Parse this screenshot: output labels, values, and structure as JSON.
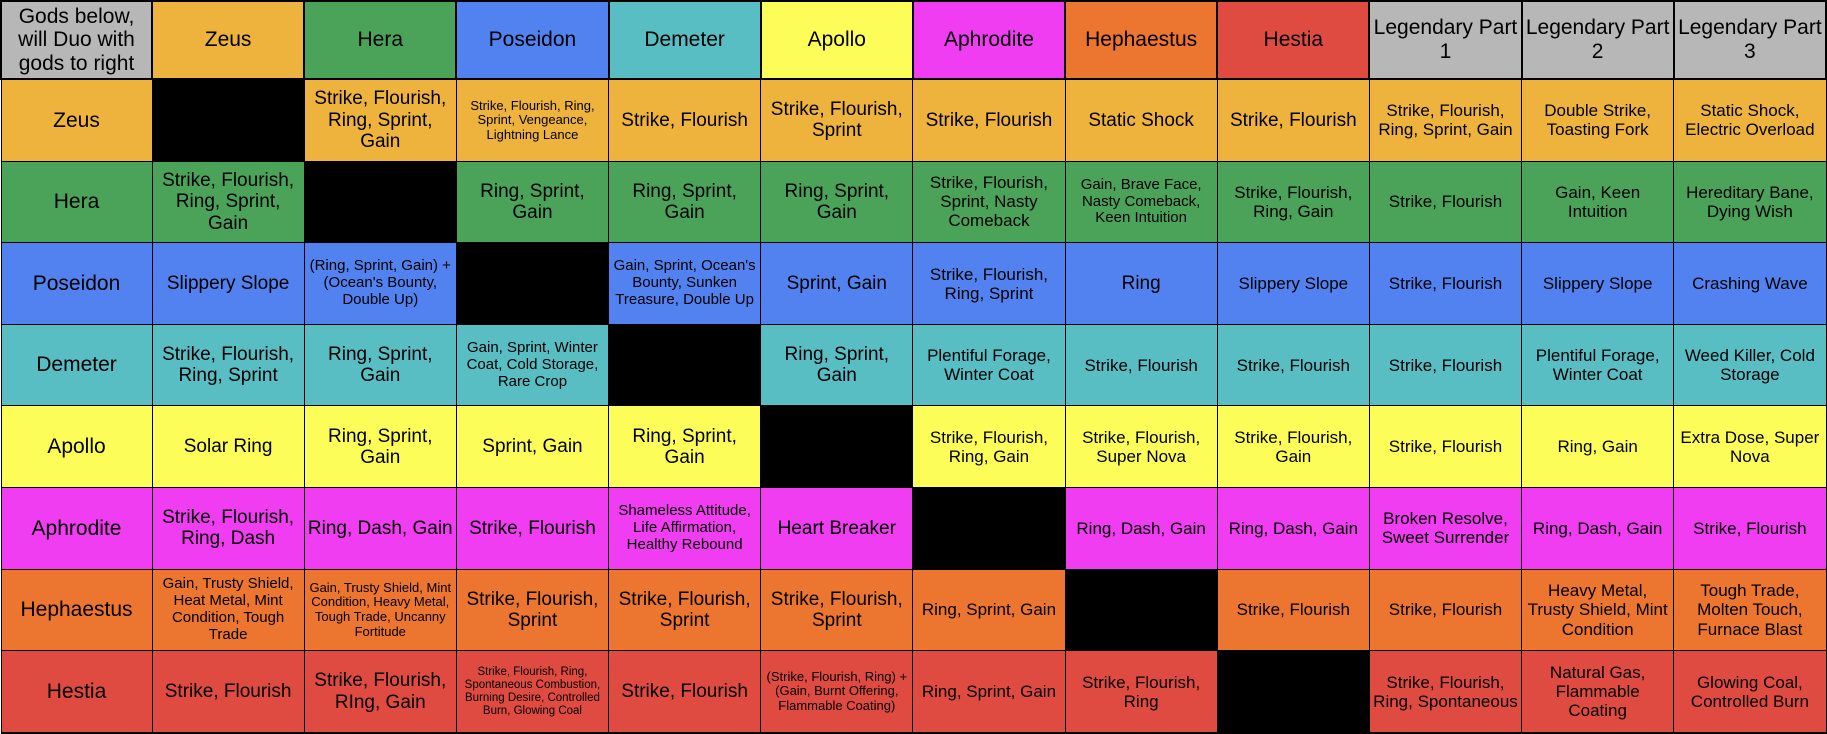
{
  "table": {
    "corner_label": "Gods below, will Duo with gods to right",
    "columns": [
      {
        "name": "Zeus",
        "color": "#eeb33c"
      },
      {
        "name": "Hera",
        "color": "#4ba35a"
      },
      {
        "name": "Poseidon",
        "color": "#5282ef"
      },
      {
        "name": "Demeter",
        "color": "#59bec4"
      },
      {
        "name": "Apollo",
        "color": "#fdfd59"
      },
      {
        "name": "Aphrodite",
        "color": "#f13df1"
      },
      {
        "name": "Hephaestus",
        "color": "#ec7530"
      },
      {
        "name": "Hestia",
        "color": "#df4b41"
      },
      {
        "name": "Legendary Part 1",
        "color": "#b7b7b7"
      },
      {
        "name": "Legendary Part 2",
        "color": "#b7b7b7"
      },
      {
        "name": "Legendary Part 3",
        "color": "#b7b7b7"
      }
    ],
    "rows": [
      {
        "label": "Zeus",
        "color": "#eeb33c",
        "cells": [
          {
            "text": "",
            "blank": true
          },
          {
            "text": "Strike, Flourish, Ring, Sprint, Gain",
            "size": "fs-lg"
          },
          {
            "text": "Strike, Flourish, Ring, Sprint, Vengeance, Lightning Lance",
            "size": "fs-xs"
          },
          {
            "text": "Strike, Flourish",
            "size": "fs-lg"
          },
          {
            "text": "Strike, Flourish, Sprint",
            "size": "fs-lg"
          },
          {
            "text": "Strike, Flourish",
            "size": "fs-lg"
          },
          {
            "text": "Static Shock",
            "size": "fs-lg"
          },
          {
            "text": "Strike, Flourish",
            "size": "fs-lg"
          },
          {
            "text": "Strike, Flourish, Ring, Sprint, Gain",
            "size": "fs-md"
          },
          {
            "text": "Double Strike, Toasting Fork",
            "size": "fs-md"
          },
          {
            "text": "Static Shock, Electric Overload",
            "size": "fs-md"
          }
        ]
      },
      {
        "label": "Hera",
        "color": "#4ba35a",
        "cells": [
          {
            "text": "Strike, Flourish, Ring, Sprint, Gain",
            "size": "fs-lg"
          },
          {
            "text": "",
            "blank": true
          },
          {
            "text": "Ring, Sprint, Gain",
            "size": "fs-lg"
          },
          {
            "text": "Ring, Sprint, Gain",
            "size": "fs-lg"
          },
          {
            "text": "Ring, Sprint, Gain",
            "size": "fs-lg"
          },
          {
            "text": "Strike, Flourish, Sprint, Nasty Comeback",
            "size": "fs-md"
          },
          {
            "text": "Gain, Brave Face, Nasty Comeback, Keen Intuition",
            "size": "fs-sm"
          },
          {
            "text": "Strike, Flourish, Ring, Gain",
            "size": "fs-md"
          },
          {
            "text": "Strike, Flourish",
            "size": "fs-md"
          },
          {
            "text": "Gain, Keen Intuition",
            "size": "fs-md"
          },
          {
            "text": "Hereditary Bane, Dying Wish",
            "size": "fs-md"
          }
        ]
      },
      {
        "label": "Poseidon",
        "color": "#5282ef",
        "cells": [
          {
            "text": "Slippery Slope",
            "size": "fs-lg"
          },
          {
            "text": "(Ring, Sprint, Gain) + (Ocean's Bounty, Double Up)",
            "size": "fs-sm"
          },
          {
            "text": "",
            "blank": true
          },
          {
            "text": "Gain, Sprint, Ocean's Bounty, Sunken Treasure, Double Up",
            "size": "fs-sm"
          },
          {
            "text": "Sprint, Gain",
            "size": "fs-lg"
          },
          {
            "text": "Strike, Flourish, Ring, Sprint",
            "size": "fs-md"
          },
          {
            "text": "Ring",
            "size": "fs-lg"
          },
          {
            "text": "Slippery Slope",
            "size": "fs-md"
          },
          {
            "text": "Strike, Flourish",
            "size": "fs-md"
          },
          {
            "text": "Slippery Slope",
            "size": "fs-md"
          },
          {
            "text": "Crashing Wave",
            "size": "fs-md"
          }
        ]
      },
      {
        "label": "Demeter",
        "color": "#59bec4",
        "cells": [
          {
            "text": "Strike, Flourish, Ring, Sprint",
            "size": "fs-lg"
          },
          {
            "text": "Ring, Sprint, Gain",
            "size": "fs-lg"
          },
          {
            "text": "Gain, Sprint, Winter Coat, Cold Storage, Rare Crop",
            "size": "fs-sm"
          },
          {
            "text": "",
            "blank": true
          },
          {
            "text": "Ring, Sprint, Gain",
            "size": "fs-lg"
          },
          {
            "text": "Plentiful Forage, Winter Coat",
            "size": "fs-md"
          },
          {
            "text": "Strike, Flourish",
            "size": "fs-md"
          },
          {
            "text": "Strike, Flourish",
            "size": "fs-md"
          },
          {
            "text": "Strike, Flourish",
            "size": "fs-md"
          },
          {
            "text": "Plentiful Forage, Winter Coat",
            "size": "fs-md"
          },
          {
            "text": "Weed Killer, Cold Storage",
            "size": "fs-md"
          }
        ]
      },
      {
        "label": "Apollo",
        "color": "#fdfd59",
        "cells": [
          {
            "text": "Solar Ring",
            "size": "fs-lg"
          },
          {
            "text": "Ring, Sprint, Gain",
            "size": "fs-lg"
          },
          {
            "text": "Sprint, Gain",
            "size": "fs-lg"
          },
          {
            "text": "Ring, Sprint, Gain",
            "size": "fs-lg"
          },
          {
            "text": "",
            "blank": true
          },
          {
            "text": "Strike, Flourish, Ring, Gain",
            "size": "fs-md"
          },
          {
            "text": "Strike, Flourish, Super Nova",
            "size": "fs-md"
          },
          {
            "text": "Strike, Flourish, Gain",
            "size": "fs-md"
          },
          {
            "text": "Strike, Flourish",
            "size": "fs-md"
          },
          {
            "text": "Ring, Gain",
            "size": "fs-md"
          },
          {
            "text": "Extra Dose, Super Nova",
            "size": "fs-md"
          }
        ]
      },
      {
        "label": "Aphrodite",
        "color": "#f13df1",
        "cells": [
          {
            "text": "Strike, Flourish, Ring, Dash",
            "size": "fs-lg"
          },
          {
            "text": "Ring, Dash, Gain",
            "size": "fs-lg"
          },
          {
            "text": "Strike, Flourish",
            "size": "fs-lg"
          },
          {
            "text": "Shameless Attitude, Life Affirmation, Healthy Rebound",
            "size": "fs-sm"
          },
          {
            "text": "Heart Breaker",
            "size": "fs-lg"
          },
          {
            "text": "",
            "blank": true
          },
          {
            "text": "Ring, Dash, Gain",
            "size": "fs-md"
          },
          {
            "text": "Ring, Dash, Gain",
            "size": "fs-md"
          },
          {
            "text": "Broken Resolve, Sweet Surrender",
            "size": "fs-md"
          },
          {
            "text": "Ring, Dash, Gain",
            "size": "fs-md"
          },
          {
            "text": "Strike, Flourish",
            "size": "fs-md"
          }
        ]
      },
      {
        "label": "Hephaestus",
        "color": "#ec7530",
        "cells": [
          {
            "text": "Gain, Trusty Shield, Heat Metal, Mint Condition, Tough Trade",
            "size": "fs-sm"
          },
          {
            "text": "Gain, Trusty Shield, Mint Condition, Heavy Metal, Tough Trade, Uncanny Fortitude",
            "size": "fs-xs"
          },
          {
            "text": "Strike, Flourish, Sprint",
            "size": "fs-lg"
          },
          {
            "text": "Strike, Flourish, Sprint",
            "size": "fs-lg"
          },
          {
            "text": "Strike, Flourish, Sprint",
            "size": "fs-lg"
          },
          {
            "text": "Ring, Sprint, Gain",
            "size": "fs-md"
          },
          {
            "text": "",
            "blank": true
          },
          {
            "text": "Strike, Flourish",
            "size": "fs-md"
          },
          {
            "text": "Strike, Flourish",
            "size": "fs-md"
          },
          {
            "text": "Heavy Metal, Trusty Shield, Mint Condition",
            "size": "fs-md"
          },
          {
            "text": "Tough Trade, Molten Touch, Furnace Blast",
            "size": "fs-md"
          }
        ]
      },
      {
        "label": "Hestia",
        "color": "#df4b41",
        "cells": [
          {
            "text": "Strike, Flourish",
            "size": "fs-lg"
          },
          {
            "text": "Strike, Flourish, RIng, Gain",
            "size": "fs-lg"
          },
          {
            "text": "Strike, Flourish, Ring, Spontaneous Combustion, Burning Desire, Controlled Burn, Glowing Coal",
            "size": "fs-xxs"
          },
          {
            "text": "Strike, Flourish",
            "size": "fs-lg"
          },
          {
            "text": "(Strike, Flourish, Ring) + (Gain, Burnt Offering, Flammable Coating)",
            "size": "fs-xs"
          },
          {
            "text": "Ring, Sprint, Gain",
            "size": "fs-md"
          },
          {
            "text": "Strike, Flourish, Ring",
            "size": "fs-md"
          },
          {
            "text": "",
            "blank": true
          },
          {
            "text": "Strike, Flourish, Ring, Spontaneous",
            "size": "fs-md"
          },
          {
            "text": "Natural Gas, Flammable Coating",
            "size": "fs-md"
          },
          {
            "text": "Glowing Coal, Controlled Burn",
            "size": "fs-md"
          }
        ]
      }
    ]
  }
}
